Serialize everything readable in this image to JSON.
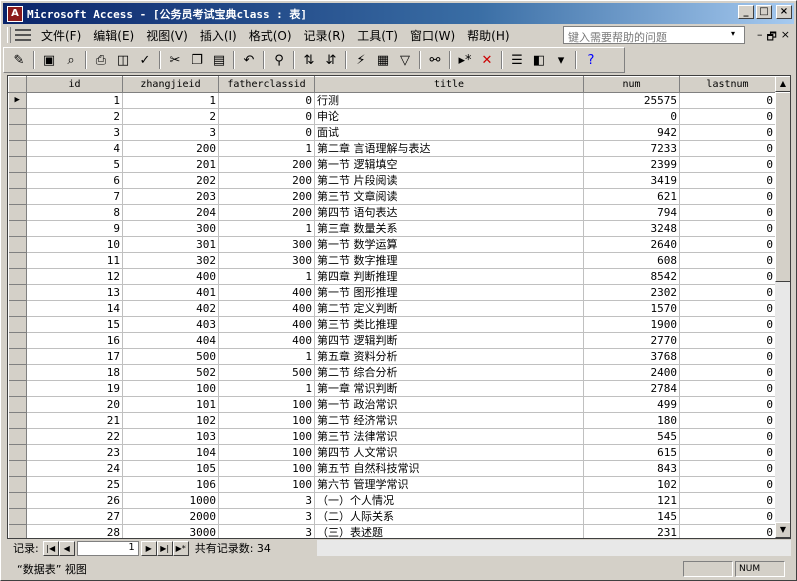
{
  "window": {
    "title": "Microsoft Access - [公务员考试宝典class : 表]",
    "app_icon": "access-key-icon",
    "controls": [
      "_",
      "□",
      "×"
    ]
  },
  "menu": {
    "items": [
      "文件(F)",
      "编辑(E)",
      "视图(V)",
      "插入(I)",
      "格式(O)",
      "记录(R)",
      "工具(T)",
      "窗口(W)",
      "帮助(H)"
    ],
    "help_placeholder": "键入需要帮助的问题",
    "mdi_controls": [
      "▾",
      "–",
      "🗗",
      "×"
    ]
  },
  "toolbar": {
    "icons": [
      "view-icon",
      "save-icon",
      "search-file-icon",
      "print-icon",
      "print-preview-icon",
      "spell-check-icon",
      "cut-icon",
      "copy-icon",
      "paste-icon",
      "undo-icon",
      "insert-hyperlink-icon",
      "sort-ascending-icon",
      "sort-descending-icon",
      "filter-by-selection-icon",
      "filter-by-form-icon",
      "apply-filter-icon",
      "find-icon",
      "new-record-icon",
      "delete-record-icon",
      "properties-icon",
      "database-window-icon",
      "new-object-icon",
      "help-icon"
    ]
  },
  "table": {
    "columns": [
      "id",
      "zhangjieid",
      "fatherclassid",
      "title",
      "num",
      "lastnum"
    ],
    "rows": [
      [
        "1",
        "1",
        "0",
        "行测",
        "25575",
        "0"
      ],
      [
        "2",
        "2",
        "0",
        "申论",
        "0",
        "0"
      ],
      [
        "3",
        "3",
        "0",
        "面试",
        "942",
        "0"
      ],
      [
        "4",
        "200",
        "1",
        "第二章  言语理解与表达",
        "7233",
        "0"
      ],
      [
        "5",
        "201",
        "200",
        "第一节  逻辑填空",
        "2399",
        "0"
      ],
      [
        "6",
        "202",
        "200",
        "第二节  片段阅读",
        "3419",
        "0"
      ],
      [
        "7",
        "203",
        "200",
        "第三节  文章阅读",
        "621",
        "0"
      ],
      [
        "8",
        "204",
        "200",
        "第四节  语句表达",
        "794",
        "0"
      ],
      [
        "9",
        "300",
        "1",
        "第三章  数量关系",
        "3248",
        "0"
      ],
      [
        "10",
        "301",
        "300",
        "第一节  数学运算",
        "2640",
        "0"
      ],
      [
        "11",
        "302",
        "300",
        "第二节  数字推理",
        "608",
        "0"
      ],
      [
        "12",
        "400",
        "1",
        "第四章  判断推理",
        "8542",
        "0"
      ],
      [
        "13",
        "401",
        "400",
        "第一节  图形推理",
        "2302",
        "0"
      ],
      [
        "14",
        "402",
        "400",
        "第二节  定义判断",
        "1570",
        "0"
      ],
      [
        "15",
        "403",
        "400",
        "第三节  类比推理",
        "1900",
        "0"
      ],
      [
        "16",
        "404",
        "400",
        "第四节  逻辑判断",
        "2770",
        "0"
      ],
      [
        "17",
        "500",
        "1",
        "第五章  资料分析",
        "3768",
        "0"
      ],
      [
        "18",
        "502",
        "500",
        "第二节  综合分析",
        "2400",
        "0"
      ],
      [
        "19",
        "100",
        "1",
        "第一章  常识判断",
        "2784",
        "0"
      ],
      [
        "20",
        "101",
        "100",
        "第一节  政治常识",
        "499",
        "0"
      ],
      [
        "21",
        "102",
        "100",
        "第二节  经济常识",
        "180",
        "0"
      ],
      [
        "22",
        "103",
        "100",
        "第三节  法律常识",
        "545",
        "0"
      ],
      [
        "23",
        "104",
        "100",
        "第四节  人文常识",
        "615",
        "0"
      ],
      [
        "24",
        "105",
        "100",
        "第五节  自然科技常识",
        "843",
        "0"
      ],
      [
        "25",
        "106",
        "100",
        "第六节  管理学常识",
        "102",
        "0"
      ],
      [
        "26",
        "1000",
        "3",
        "（一）个人情况",
        "121",
        "0"
      ],
      [
        "27",
        "2000",
        "3",
        "（二）人际关系",
        "145",
        "0"
      ],
      [
        "28",
        "3000",
        "3",
        "（三）表述题",
        "231",
        "0"
      ]
    ],
    "current_row_marker": "▶"
  },
  "navigation": {
    "label": "记录:",
    "current_record": "1",
    "buttons": [
      "|◀",
      "◀",
      "▶",
      "▶|",
      "▶*"
    ],
    "total_text": "共有记录数: 34"
  },
  "statusbar": {
    "text": "“数据表” 视图",
    "num_indicator": "NUM"
  }
}
